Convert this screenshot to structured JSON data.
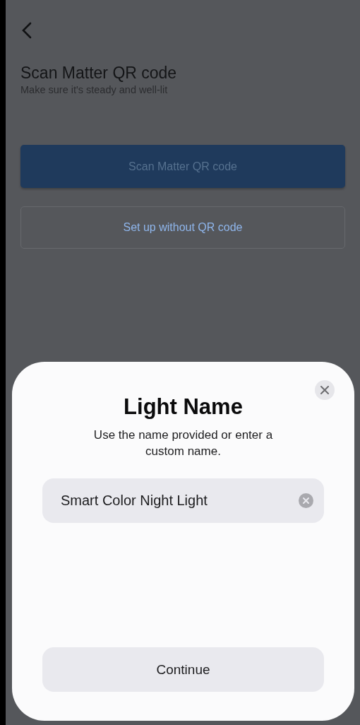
{
  "screen": {
    "title": "Scan Matter QR code",
    "subtitle": "Make sure it's steady and well-lit",
    "buttons": [
      {
        "label": "Scan Matter QR code",
        "kind": "primary"
      },
      {
        "label": "Set up without QR code",
        "kind": "secondary"
      }
    ]
  },
  "sheet": {
    "title": "Light Name",
    "message": "Use the name provided or enter a custom name.",
    "name_field": {
      "value": "Smart Color Night Light"
    },
    "button": "Continue"
  }
}
